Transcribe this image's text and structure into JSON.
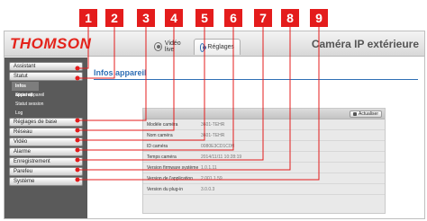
{
  "callouts": [
    "1",
    "2",
    "3",
    "4",
    "5",
    "6",
    "7",
    "8",
    "9"
  ],
  "header": {
    "logo": "THOMSON",
    "tabs": [
      {
        "label": "Vidéo live"
      },
      {
        "label": "Réglages"
      }
    ],
    "app_title": "Caméra IP extérieure"
  },
  "sidebar": {
    "items": [
      {
        "label": "Assistant"
      },
      {
        "label": "Statut"
      },
      {
        "label": "Infos appareil"
      },
      {
        "label": "Statut appareil"
      },
      {
        "label": "Statut session"
      },
      {
        "label": "Log"
      },
      {
        "label": "Réglages de base"
      },
      {
        "label": "Réseau"
      },
      {
        "label": "Vidéo"
      },
      {
        "label": "Alarme"
      },
      {
        "label": "Enregistrement"
      },
      {
        "label": "Parefeu"
      },
      {
        "label": "Système"
      }
    ]
  },
  "main": {
    "title": "Infos appareil",
    "refresh_label": "Actualiser",
    "rows": [
      {
        "label": "Modèle caméra",
        "value": "3601-TEHR"
      },
      {
        "label": "Nom caméra",
        "value": "3601-TEHR"
      },
      {
        "label": "ID caméra",
        "value": "0080E3CD1C0H"
      },
      {
        "label": "Temps caméra",
        "value": "2014/11/11 10:28:19"
      },
      {
        "label": "Version firmware système",
        "value": "1.0.1.11"
      },
      {
        "label": "Version de l'application",
        "value": "2.001.1.59"
      },
      {
        "label": "Version du plug-in",
        "value": "3.0.0.3"
      }
    ]
  },
  "colors": {
    "callout_red": "#e41c1c",
    "brand_red": "#e4231b",
    "sidebar_bg": "#5a5a5a",
    "title_blue": "#2f6fb5"
  }
}
